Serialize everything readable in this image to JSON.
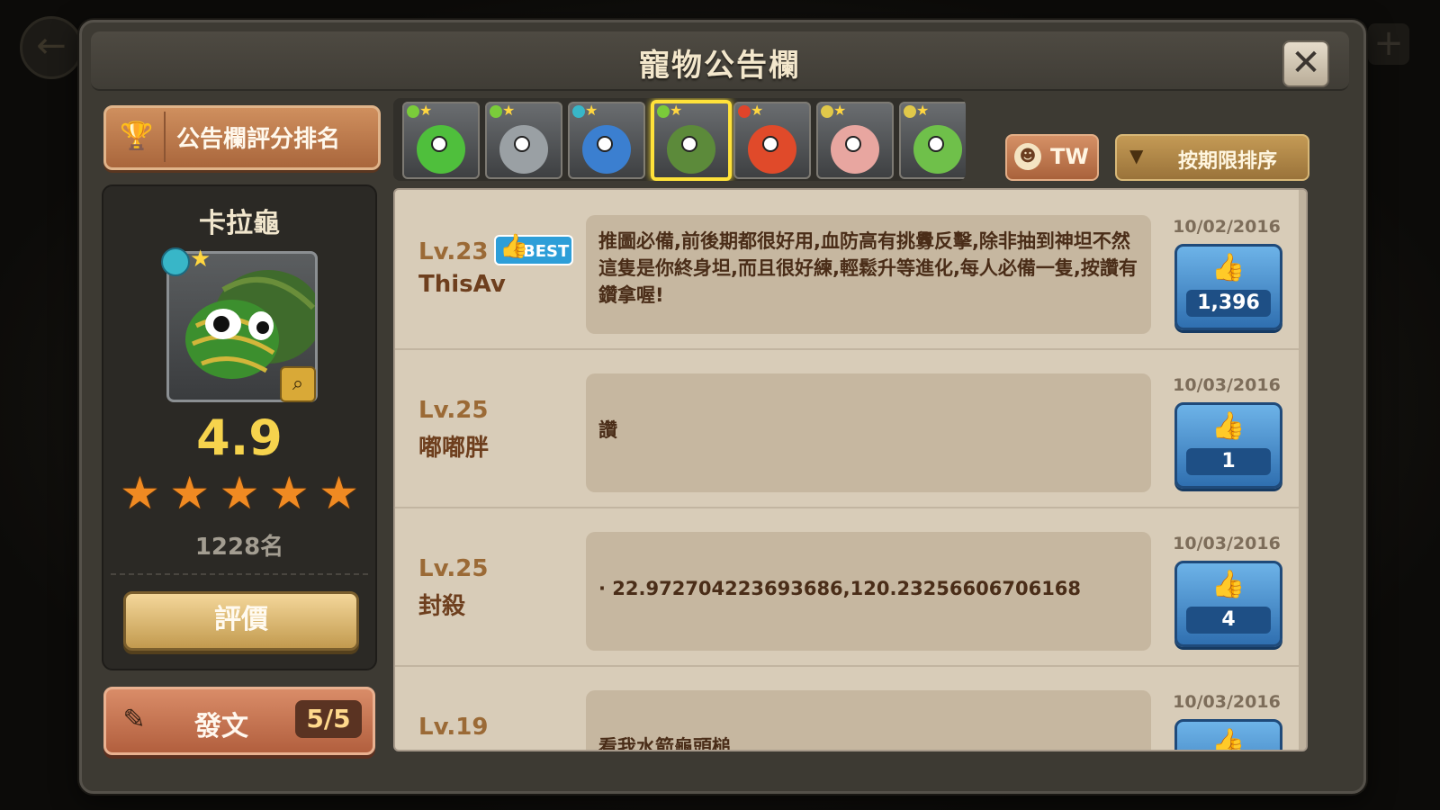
{
  "dialog": {
    "title": "寵物公告欄",
    "close_label": "✕"
  },
  "rank_button": {
    "label": "公告欄評分排名",
    "icon": "trophy-icon"
  },
  "pet": {
    "name": "卡拉龜",
    "score": "4.9",
    "rating_stars": 5,
    "rank": "1228名",
    "rate_label": "評價",
    "element_color": "#38b6c8",
    "star_color": "#f08a22"
  },
  "post_button": {
    "label": "發文",
    "count": "5/5",
    "icon": "edit-icon"
  },
  "thumbnails": [
    {
      "color": "#4fbf3c",
      "elem": "#7acb3a",
      "selected": false
    },
    {
      "color": "#9aa0a4",
      "elem": "#7acb3a",
      "selected": false
    },
    {
      "color": "#3b7fd0",
      "elem": "#38b6c8",
      "selected": false
    },
    {
      "color": "#5c8a3a",
      "elem": "#7acb3a",
      "selected": true
    },
    {
      "color": "#e04a2a",
      "elem": "#e0442a",
      "selected": false
    },
    {
      "color": "#e8a6a0",
      "elem": "#e0c84a",
      "selected": false
    },
    {
      "color": "#6fc04a",
      "elem": "#e0c84a",
      "selected": false
    }
  ],
  "region_button": {
    "label": "TW",
    "icon": "skull-icon"
  },
  "sort_button": {
    "label": "按期限排序",
    "icon": "triangle-down-icon"
  },
  "posts": [
    {
      "level": "Lv.23",
      "user": "ThisAv",
      "best": true,
      "best_label": "BEST",
      "text": "推圖必備,前後期都很好用,血防高有挑釁反擊,除非抽到神坦不然這隻是你終身坦,而且很好練,輕鬆升等進化,每人必備一隻,按讚有鑽拿喔!",
      "date": "10/02/2016",
      "likes": "1,396"
    },
    {
      "level": "Lv.25",
      "user": "嘟嘟胖",
      "best": false,
      "best_label": "",
      "text": "讚",
      "date": "10/03/2016",
      "likes": "1"
    },
    {
      "level": "Lv.25",
      "user": "封殺",
      "best": false,
      "best_label": "",
      "text": "· 22.972704223693686,120.23256606706168",
      "date": "10/03/2016",
      "likes": "4"
    },
    {
      "level": "Lv.19",
      "user": "",
      "best": false,
      "best_label": "",
      "text": "看我水箭龜頭槌",
      "date": "10/03/2016",
      "likes": ""
    }
  ]
}
